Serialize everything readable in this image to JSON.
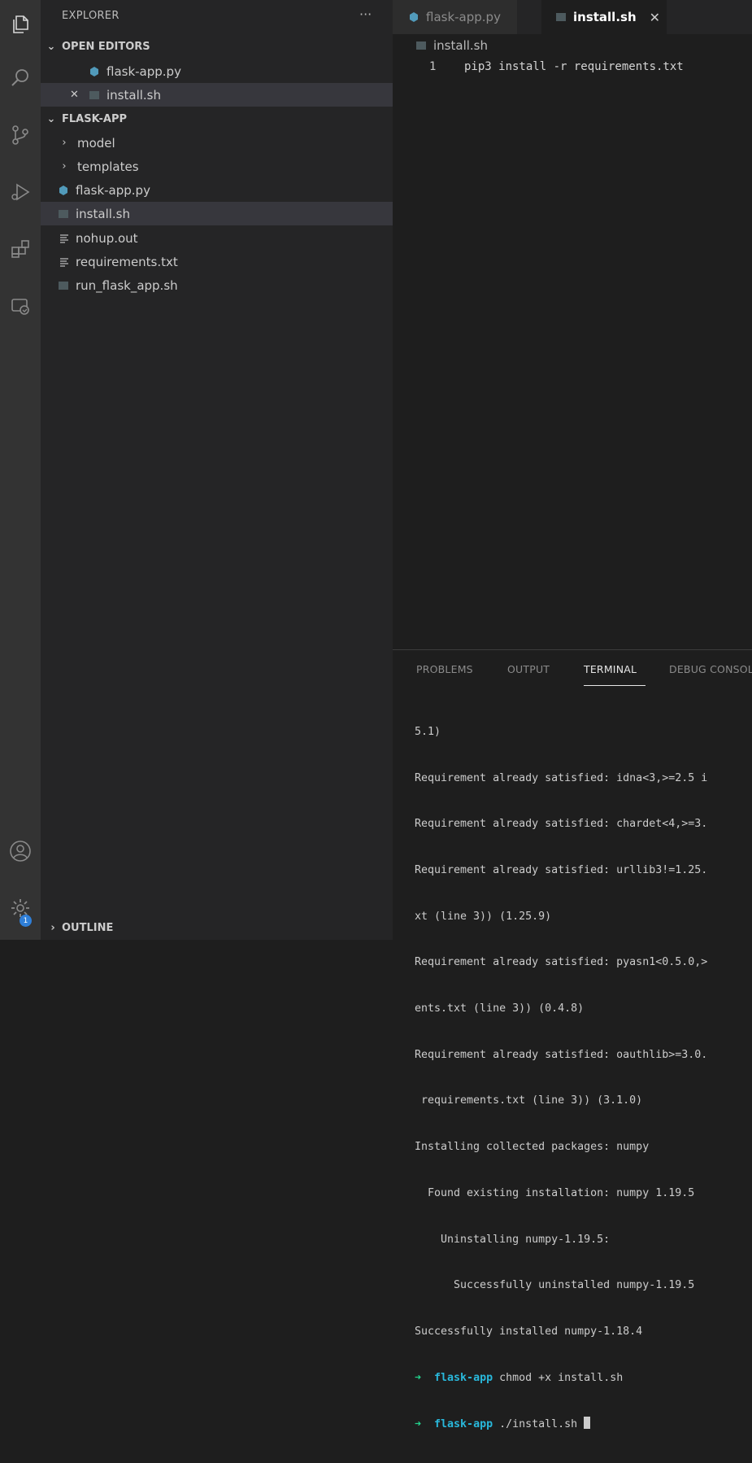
{
  "activity_bar": {
    "items": [
      "explorer-icon",
      "search-icon",
      "source-control-icon",
      "run-debug-icon",
      "extensions-icon",
      "remote-explorer-icon"
    ],
    "bottom": [
      "account-icon",
      "settings-gear-icon"
    ],
    "settings_badge": "1"
  },
  "explorer": {
    "title": "EXPLORER",
    "more": "···",
    "open_editors": {
      "title": "OPEN EDITORS",
      "items": [
        {
          "label": "flask-app.py"
        },
        {
          "label": "install.sh"
        }
      ]
    },
    "folder": {
      "title": "FLASK-APP",
      "items": [
        {
          "label": "model"
        },
        {
          "label": "templates"
        },
        {
          "label": "flask-app.py"
        },
        {
          "label": "install.sh"
        },
        {
          "label": "nohup.out"
        },
        {
          "label": "requirements.txt"
        },
        {
          "label": "run_flask_app.sh"
        }
      ]
    },
    "outline_title": "OUTLINE"
  },
  "tabs": [
    {
      "label": "flask-app.py"
    },
    {
      "label": "install.sh",
      "close": "✕"
    }
  ],
  "breadcrumb": "install.sh",
  "editor": {
    "line_number": "1",
    "line_text": "pip3 install -r requirements.txt"
  },
  "panel": {
    "tabs": [
      "PROBLEMS",
      "OUTPUT",
      "TERMINAL",
      "DEBUG CONSOLE"
    ],
    "terminal_lines": [
      "5.1)",
      "Requirement already satisfied: idna<3,>=2.5 i",
      "Requirement already satisfied: chardet<4,>=3.",
      "Requirement already satisfied: urllib3!=1.25.",
      "xt (line 3)) (1.25.9)",
      "Requirement already satisfied: pyasn1<0.5.0,>",
      "ents.txt (line 3)) (0.4.8)",
      "Requirement already satisfied: oauthlib>=3.0.",
      " requirements.txt (line 3)) (3.1.0)",
      "Installing collected packages: numpy",
      "  Found existing installation: numpy 1.19.5",
      "    Uninstalling numpy-1.19.5:",
      "      Successfully uninstalled numpy-1.19.5",
      "Successfully installed numpy-1.18.4"
    ],
    "prompts": [
      {
        "arrow": "➜",
        "dir": "flask-app",
        "cmd": "chmod +x install.sh"
      },
      {
        "arrow": "➜",
        "dir": "flask-app",
        "cmd": "./install.sh"
      }
    ]
  },
  "colors": {
    "python_icon": "#519aba",
    "shell_icon": "#4d5a5e",
    "prompt_arrow": "#23d18b",
    "prompt_dir": "#29b8db"
  }
}
